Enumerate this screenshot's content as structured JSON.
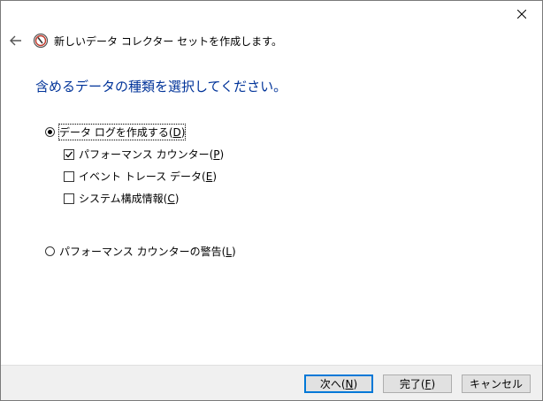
{
  "header": {
    "title": "新しいデータ コレクター セットを作成します。"
  },
  "heading": "含めるデータの種類を選択してください。",
  "options": {
    "create_log": {
      "label": "データ ログを作成する",
      "key": "D",
      "selected": true
    },
    "perf_counter": {
      "label": "パフォーマンス カウンター",
      "key": "P",
      "checked": true
    },
    "event_trace": {
      "label": "イベント トレース データ",
      "key": "E",
      "checked": false
    },
    "system_config": {
      "label": "システム構成情報",
      "key": "C",
      "checked": false
    },
    "perf_alert": {
      "label": "パフォーマンス カウンターの警告",
      "key": "L",
      "selected": false
    }
  },
  "buttons": {
    "next": {
      "label": "次へ",
      "key": "N"
    },
    "finish": {
      "label": "完了",
      "key": "F"
    },
    "cancel": {
      "label": "キャンセル"
    }
  },
  "icons": {
    "close": "close-icon",
    "back": "back-arrow-icon",
    "app": "performance-monitor-icon"
  },
  "colors": {
    "heading": "#003399",
    "default_button_border": "#0078d7"
  }
}
